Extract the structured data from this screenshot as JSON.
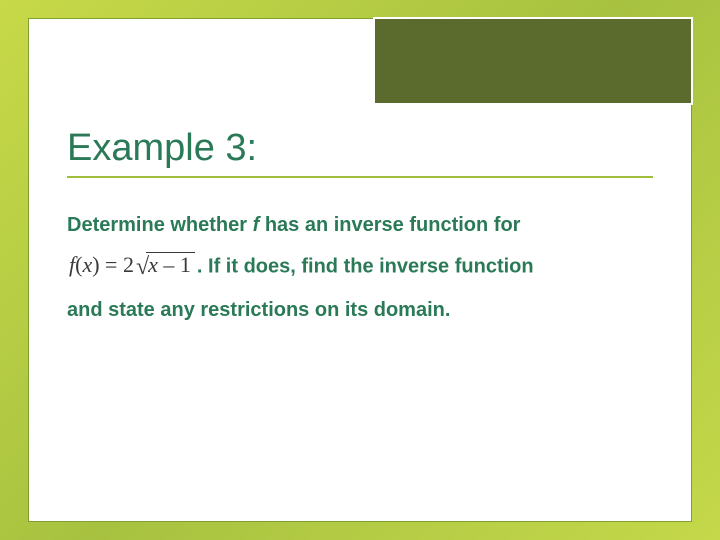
{
  "title": "Example 3:",
  "body": {
    "line1_pre": "Determine whether ",
    "line1_var": "f",
    "line1_post": " has an inverse function for",
    "formula": {
      "lhs_f": "f",
      "lhs_x": "x",
      "eq": " = ",
      "coef": "2",
      "rad_a": "x",
      "rad_op": " – ",
      "rad_b": "1"
    },
    "after_formula": ".  If it does, find the inverse function",
    "line3": "and state any restrictions on its domain."
  }
}
